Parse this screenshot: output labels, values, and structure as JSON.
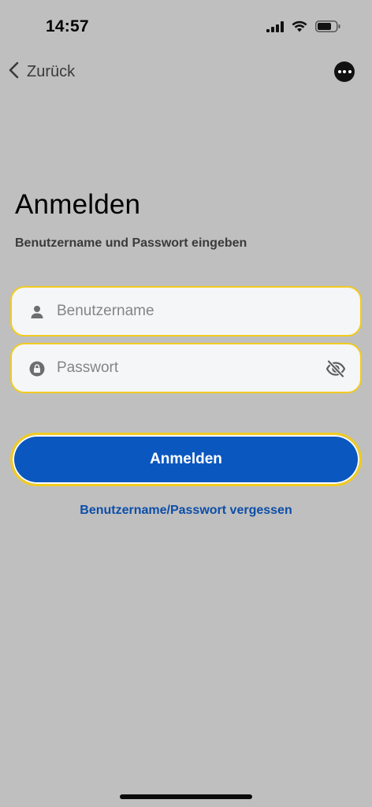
{
  "status_bar": {
    "time": "14:57"
  },
  "nav": {
    "back_label": "Zurück"
  },
  "login": {
    "title": "Anmelden",
    "subtitle": "Benutzername und Passwort eingeben",
    "username_placeholder": "Benutzername",
    "password_placeholder": "Passwort",
    "submit_label": "Anmelden",
    "forgot_label": "Benutzername/Passwort vergessen"
  },
  "colors": {
    "background": "#bfbfbf",
    "field_border": "#f2cb1f",
    "primary_button": "#0b57c0",
    "link": "#0d4ea8"
  },
  "icons": [
    "chevron-left-icon",
    "more-icon",
    "user-icon",
    "lock-icon",
    "eye-slash-icon",
    "signal-icon",
    "wifi-icon",
    "battery-icon"
  ]
}
